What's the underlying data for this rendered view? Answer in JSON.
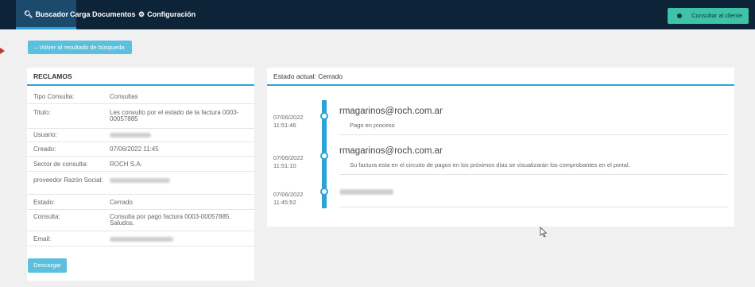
{
  "nav": {
    "items": [
      {
        "label": "Buscador",
        "icon": "search-icon"
      },
      {
        "label": "Carga Documentos"
      },
      {
        "label": "Configuración",
        "icon": "gear-icon"
      }
    ],
    "cta_label": "Consultar al cliente"
  },
  "back_label": "Volver al resultado de búsqueda",
  "claims": {
    "title": "RECLAMOS",
    "rows": [
      {
        "label": "Tipo Consulta:",
        "value": "Consultas"
      },
      {
        "label": "Titulo:",
        "value": "Les consulto por el estado de la factura 0003-00057885"
      },
      {
        "label": "Usuario:",
        "value": ""
      },
      {
        "label": "Creado:",
        "value": "07/06/2022 11:45"
      },
      {
        "label": "Sector de consulta:",
        "value": "ROCH S.A."
      },
      {
        "label": "proveedor Razón Social:",
        "value": ""
      },
      {
        "label": "Estado:",
        "value": "Cerrado"
      },
      {
        "label": "Consulta:",
        "value": "Consulta por pago factura 0003-00057885. Saludos."
      },
      {
        "label": "Email:",
        "value": ""
      }
    ],
    "download_label": "Descargar"
  },
  "status": {
    "title": "Estado actual: Cerrado",
    "timeline": [
      {
        "date": "07/06/2022",
        "time": "11:51:46",
        "user": "rmagarinos@roch.com.ar",
        "message": "Pago en proceso"
      },
      {
        "date": "07/06/2022",
        "time": "11:51:10",
        "user": "rmagarinos@roch.com.ar",
        "message": "Su factura esta en el circuito de pagos en los próximos días se visualizarán los comprobantes en el portal."
      },
      {
        "date": "07/06/2022",
        "time": "11:45:52",
        "user": "",
        "message": ""
      }
    ]
  },
  "colors": {
    "nav_bg": "#0d2438",
    "accent": "#2ba3d9",
    "button": "#5bc0de",
    "cta": "#3ec3a8"
  }
}
